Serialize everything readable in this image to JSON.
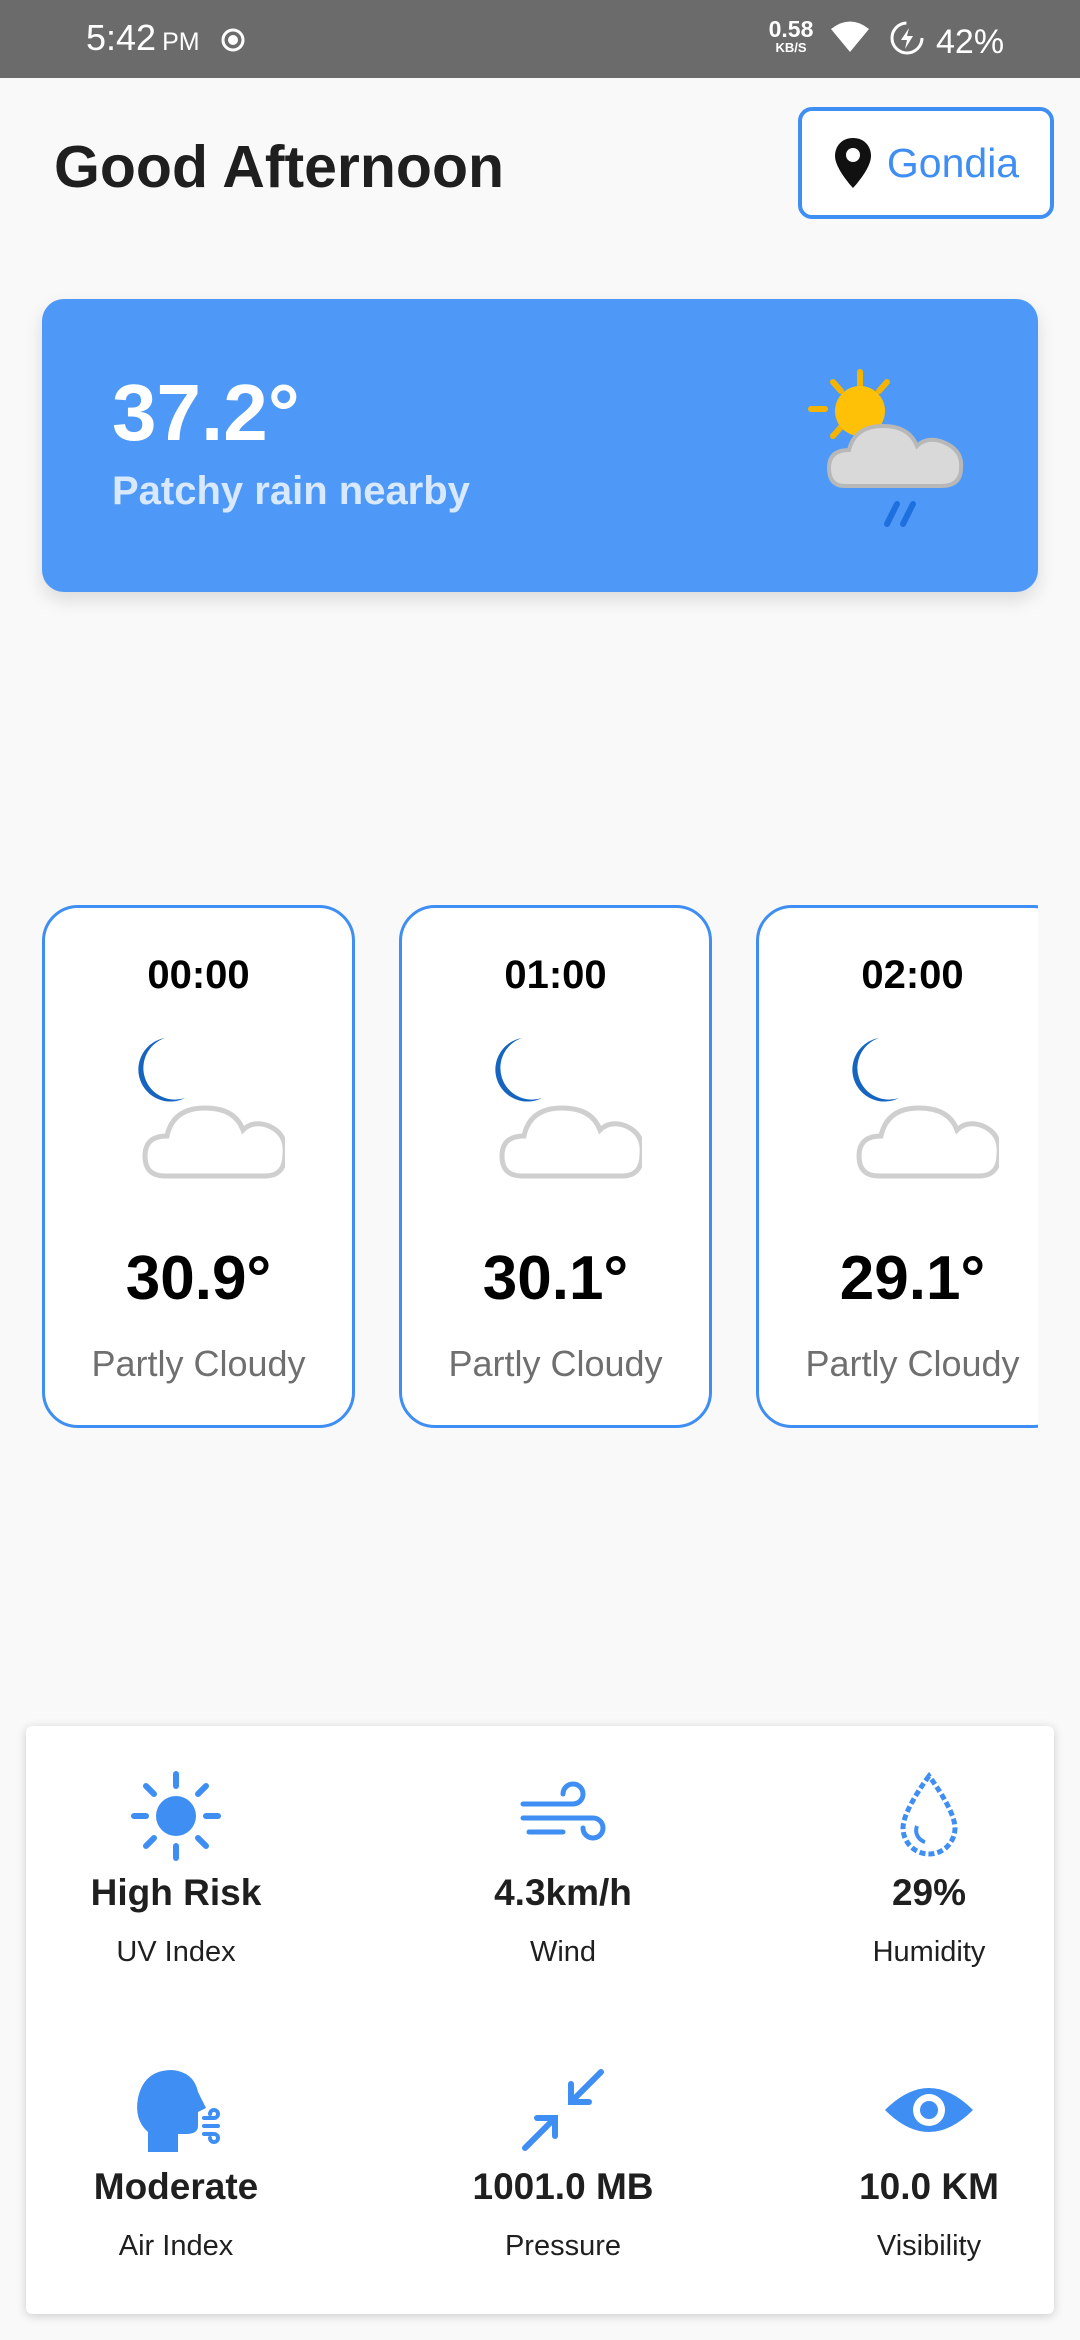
{
  "status_bar": {
    "time": "5:42",
    "ampm": "PM",
    "net_speed": "0.58",
    "net_unit": "KB/S",
    "battery": "42%",
    "icons": [
      "record-icon",
      "wifi-icon",
      "battery-charging-icon"
    ]
  },
  "header": {
    "greeting": "Good Afternoon",
    "location": "Gondia",
    "location_icon": "map-pin-icon"
  },
  "current": {
    "temperature": "37.2°",
    "condition": "Patchy rain nearby",
    "icon": "sun-cloud-rain-icon"
  },
  "hourly": [
    {
      "time": "00:00",
      "temp": "30.9°",
      "condition": "Partly Cloudy",
      "icon": "moon-cloud-icon"
    },
    {
      "time": "01:00",
      "temp": "30.1°",
      "condition": "Partly Cloudy",
      "icon": "moon-cloud-icon"
    },
    {
      "time": "02:00",
      "temp": "29.1°",
      "condition": "Partly Cloudy",
      "icon": "moon-cloud-icon"
    }
  ],
  "stats": [
    {
      "value": "High Risk",
      "label": "UV Index",
      "icon": "sun-icon"
    },
    {
      "value": "4.3km/h",
      "label": "Wind",
      "icon": "wind-icon"
    },
    {
      "value": "29%",
      "label": "Humidity",
      "icon": "droplet-icon"
    },
    {
      "value": "Moderate",
      "label": "Air Index",
      "icon": "head-breath-icon"
    },
    {
      "value": "1001.0 MB",
      "label": "Pressure",
      "icon": "compress-arrows-icon"
    },
    {
      "value": "10.0 KM",
      "label": "Visibility",
      "icon": "eye-icon"
    }
  ],
  "colors": {
    "accent": "#3f8ef3",
    "card": "#4e99f7",
    "status_bar": "#6b6b6b",
    "moon": "#1565c0"
  }
}
